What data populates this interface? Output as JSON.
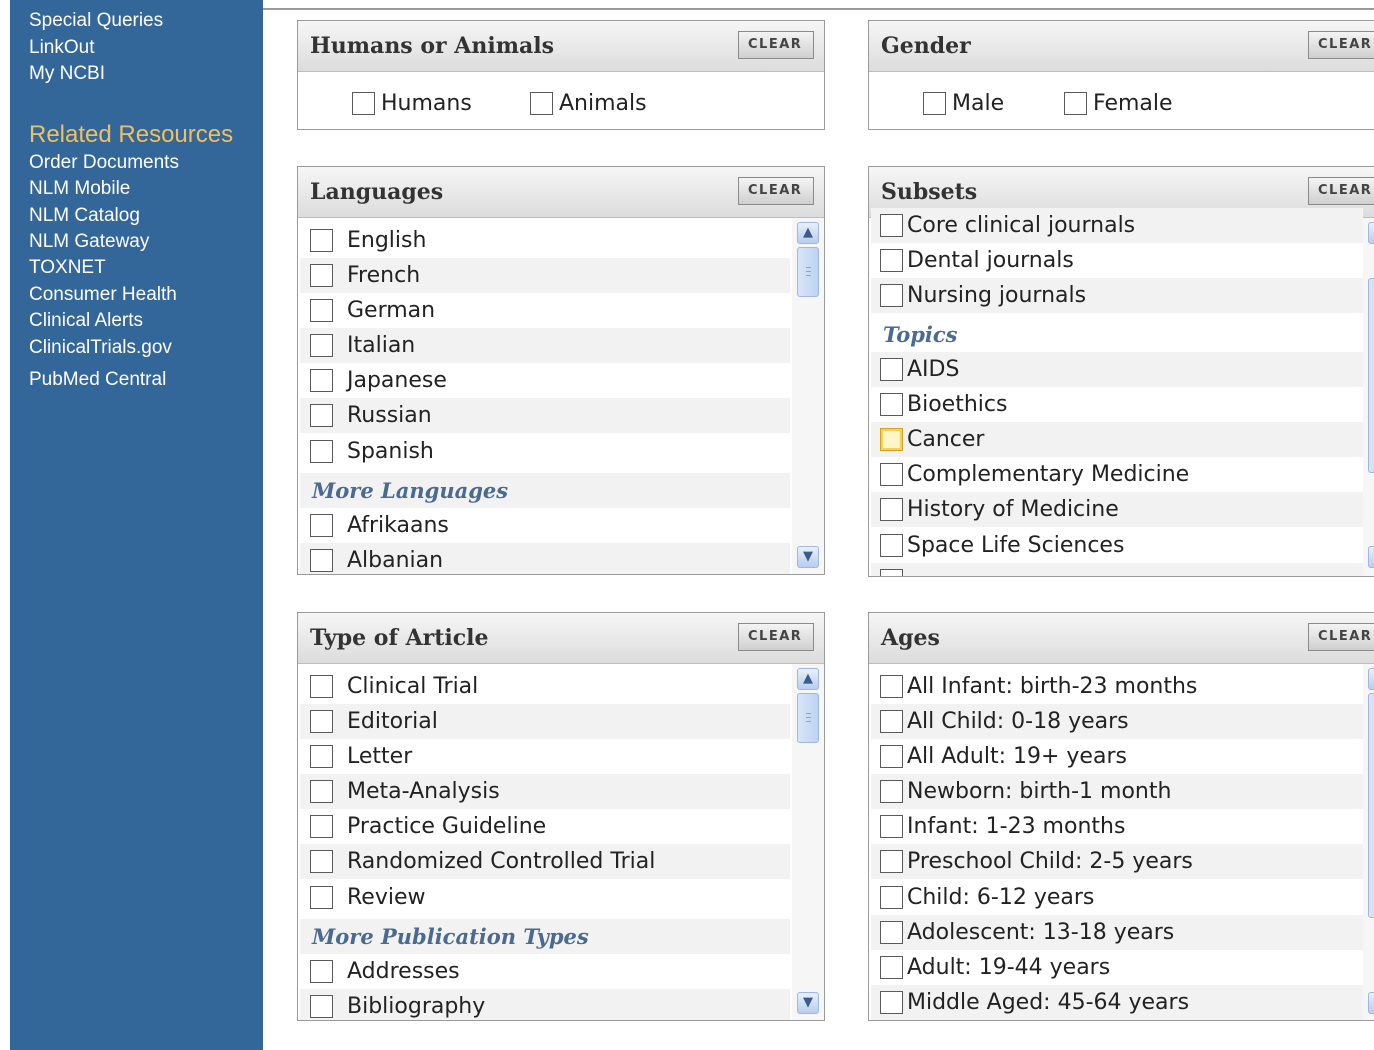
{
  "sidebar": {
    "links_top": [
      "Special Queries",
      "LinkOut",
      "My NCBI"
    ],
    "heading": "Related Resources",
    "links": [
      "Order Documents",
      "NLM Mobile",
      "NLM Catalog",
      "NLM Gateway",
      "TOXNET",
      "Consumer Health",
      "Clinical Alerts",
      "ClinicalTrials.gov",
      "PubMed Central"
    ]
  },
  "panels": {
    "humans": {
      "title": "Humans or Animals",
      "clear": "CLEAR",
      "options": [
        "Humans",
        "Animals"
      ]
    },
    "gender": {
      "title": "Gender",
      "clear": "CLEAR",
      "options": [
        "Male",
        "Female"
      ]
    },
    "languages": {
      "title": "Languages",
      "clear": "CLEAR",
      "items": [
        "English",
        "French",
        "German",
        "Italian",
        "Japanese",
        "Russian",
        "Spanish"
      ],
      "more_label": "More Languages",
      "more_items": [
        "Afrikaans",
        "Albanian"
      ]
    },
    "subsets": {
      "title": "Subsets",
      "clear": "CLEAR",
      "items": [
        "Core clinical journals",
        "Dental journals",
        "Nursing journals"
      ],
      "topics_label": "Topics",
      "topics": [
        "AIDS",
        "Bioethics",
        "Cancer",
        "Complementary Medicine",
        "History of Medicine",
        "Space Life Sciences"
      ]
    },
    "article": {
      "title": "Type of Article",
      "clear": "CLEAR",
      "items": [
        "Clinical Trial",
        "Editorial",
        "Letter",
        "Meta-Analysis",
        "Practice Guideline",
        "Randomized Controlled Trial",
        "Review"
      ],
      "more_label": "More Publication Types",
      "more_items": [
        "Addresses",
        "Bibliography"
      ]
    },
    "ages": {
      "title": "Ages",
      "clear": "CLEAR",
      "items": [
        "All Infant: birth-23 months",
        "All Child: 0-18 years",
        "All Adult: 19+ years",
        "Newborn: birth-1 month",
        "Infant: 1-23 months",
        "Preschool Child: 2-5 years",
        "Child: 6-12 years",
        "Adolescent: 13-18 years",
        "Adult: 19-44 years",
        "Middle Aged: 45-64 years"
      ]
    }
  }
}
